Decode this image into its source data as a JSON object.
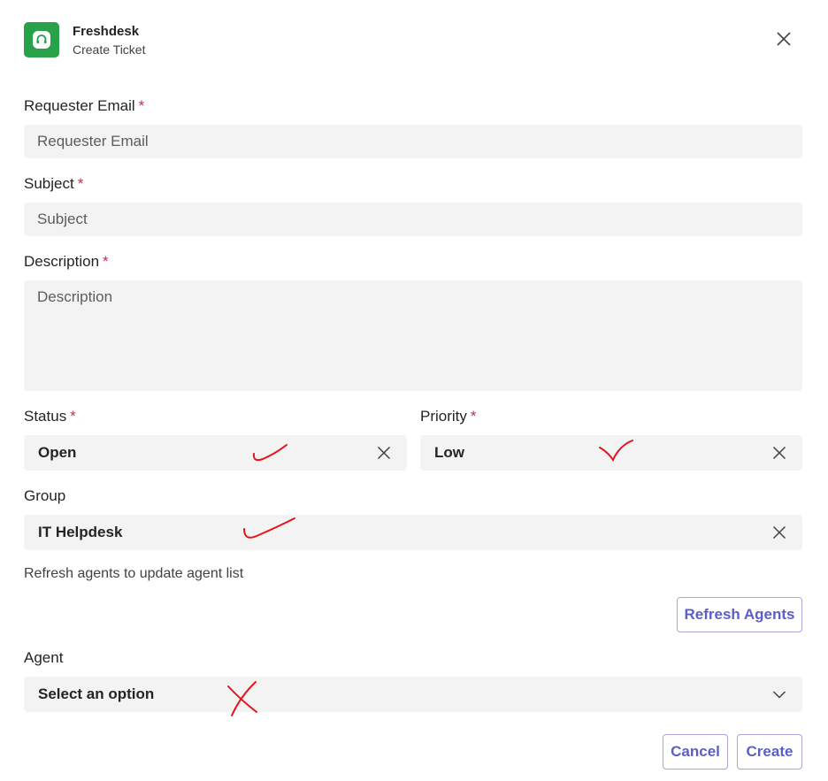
{
  "header": {
    "app_name": "Freshdesk",
    "subtitle": "Create Ticket",
    "icon": "freshdesk-headset-icon",
    "close_icon": "close-icon"
  },
  "form": {
    "required_marker": "*",
    "requester_email": {
      "label": "Requester Email",
      "placeholder": "Requester Email",
      "value": ""
    },
    "subject": {
      "label": "Subject",
      "placeholder": "Subject",
      "value": ""
    },
    "description": {
      "label": "Description",
      "placeholder": "Description",
      "value": ""
    },
    "status": {
      "label": "Status",
      "value": "Open"
    },
    "priority": {
      "label": "Priority",
      "value": "Low"
    },
    "group": {
      "label": "Group",
      "value": "IT Helpdesk"
    },
    "refresh_hint": "Refresh agents to update agent list",
    "refresh_button": "Refresh Agents",
    "agent": {
      "label": "Agent",
      "value": "Select an option"
    }
  },
  "footer": {
    "cancel": "Cancel",
    "create": "Create"
  },
  "colors": {
    "brand_green": "#27a24a",
    "accent": "#5b5fc7",
    "required": "#c4314b",
    "annotation_red": "#e8121a"
  }
}
